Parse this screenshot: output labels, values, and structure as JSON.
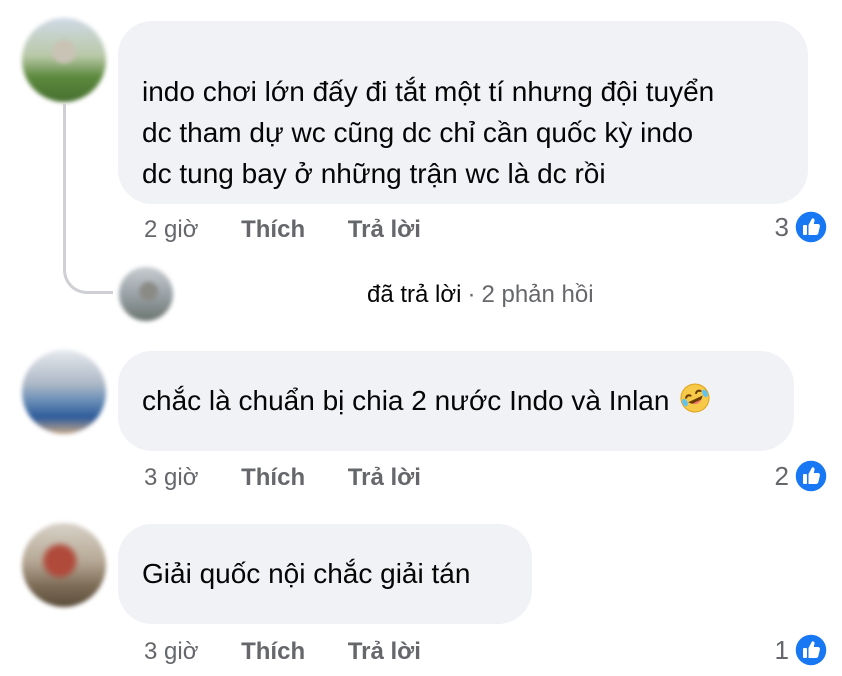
{
  "comments": [
    {
      "text_lines": [
        "indo chơi lớn đấy đi tắt một tí nhưng đội tuyển",
        "dc tham dự wc cũng dc chỉ cần quốc kỳ indo",
        "dc tung bay ở những trận wc là dc rồi"
      ],
      "time": "2 giờ",
      "like_label": "Thích",
      "reply_label": "Trả lời",
      "reaction_count": "3",
      "reaction_icon": "like-icon"
    },
    {
      "text_lines": [
        "chắc là chuẩn bị chia 2 nước Indo và Inlan"
      ],
      "emoji": "rolling-on-floor-laughing",
      "time": "3 giờ",
      "like_label": "Thích",
      "reply_label": "Trả lời",
      "reaction_count": "2",
      "reaction_icon": "like-icon"
    },
    {
      "text_lines": [
        "Giải quốc nội chắc giải tán"
      ],
      "time": "3 giờ",
      "like_label": "Thích",
      "reply_label": "Trả lời",
      "reaction_count": "1",
      "reaction_icon": "like-icon"
    }
  ],
  "reply_summary": {
    "action": "đã trả lời",
    "separator": "·",
    "count_text": "2 phản hồi"
  },
  "colors": {
    "bubble_bg": "#f0f2f5",
    "meta_text": "#65676b",
    "like_blue": "#1877f2"
  }
}
